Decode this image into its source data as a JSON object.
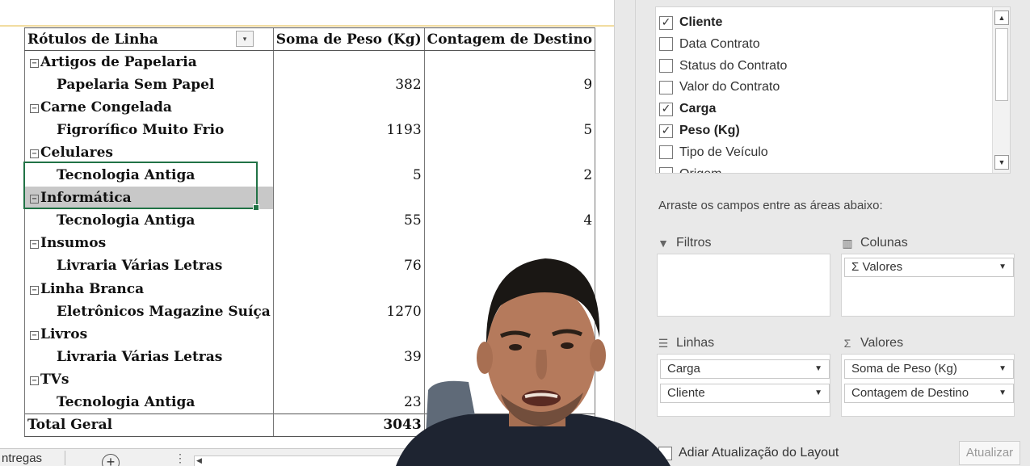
{
  "pivot": {
    "headers": {
      "row_labels": "Rótulos de Linha",
      "sum_weight": "Soma de Peso (Kg)",
      "count_dest": "Contagem de Destino"
    },
    "rows": [
      {
        "label": "Artigos de Papelaria"
      },
      {
        "label": "Papelaria Sem Papel",
        "weight": "382",
        "count": "9"
      },
      {
        "label": "Carne Congelada"
      },
      {
        "label": "Figrorífico Muito Frio",
        "weight": "1193",
        "count": "5"
      },
      {
        "label": "Celulares"
      },
      {
        "label": "Tecnologia Antiga",
        "weight": "5",
        "count": "2"
      },
      {
        "label": "Informática"
      },
      {
        "label": "Tecnologia Antiga",
        "weight": "55",
        "count": "4"
      },
      {
        "label": "Insumos"
      },
      {
        "label": "Livraria Várias Letras",
        "weight": "76",
        "count": ""
      },
      {
        "label": "Linha Branca"
      },
      {
        "label": "Eletrônicos Magazine Suíça",
        "weight": "1270",
        "count": ""
      },
      {
        "label": "Livros"
      },
      {
        "label": "Livraria Várias Letras",
        "weight": "39",
        "count": ""
      },
      {
        "label": "TVs"
      },
      {
        "label": "Tecnologia Antiga",
        "weight": "23",
        "count": ""
      }
    ],
    "total": {
      "label": "Total Geral",
      "weight": "3043",
      "count": ""
    },
    "collapse_symbol": "−",
    "filter_symbol": "▾"
  },
  "sheet_tabs": {
    "active_tab": "ntregas",
    "add_symbol": "+",
    "more_symbol": "⋮",
    "scroll_left": "◀"
  },
  "field_list": {
    "fields": [
      {
        "label": "Cliente",
        "checked": true
      },
      {
        "label": "Data Contrato",
        "checked": false
      },
      {
        "label": "Status do Contrato",
        "checked": false
      },
      {
        "label": "Valor do Contrato",
        "checked": false
      },
      {
        "label": "Carga",
        "checked": true
      },
      {
        "label": "Peso (Kg)",
        "checked": true
      },
      {
        "label": "Tipo de Veículo",
        "checked": false
      },
      {
        "label": "Origem",
        "checked": false
      }
    ],
    "check_mark": "✓",
    "hint": "Arraste os campos entre as áreas abaixo:",
    "areas": {
      "filters": {
        "label": "Filtros",
        "icon": "filter-icon",
        "glyph": "▼",
        "items": []
      },
      "columns": {
        "label": "Colunas",
        "icon": "columns-icon",
        "glyph": "▥",
        "items": [
          "Σ Valores"
        ]
      },
      "rows": {
        "label": "Linhas",
        "icon": "rows-icon",
        "glyph": "☰",
        "items": [
          "Carga",
          "Cliente"
        ]
      },
      "values": {
        "label": "Valores",
        "icon": "sigma-icon",
        "glyph": "Σ",
        "items": [
          "Soma de Peso (Kg)",
          "Contagem de Destino"
        ]
      }
    },
    "defer_label": "Adiar Atualização do Layout",
    "update_label": "Atualizar"
  },
  "colors": {
    "selection": "#217346",
    "selected_row": "#c8c8c8",
    "pane_bg": "#e9e9e9"
  }
}
